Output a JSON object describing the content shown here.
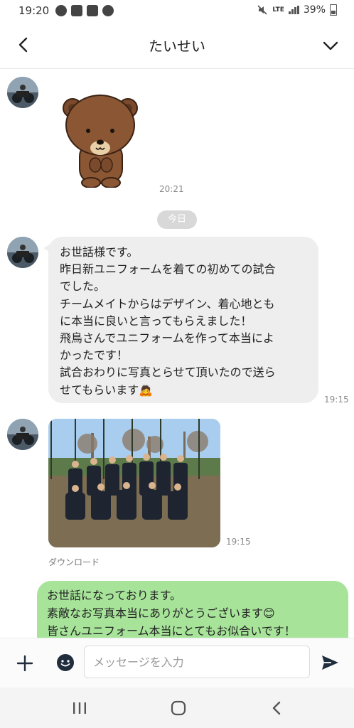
{
  "status_bar": {
    "time": "19:20",
    "network": "LTE",
    "battery": "39%"
  },
  "header": {
    "title": "たいせい"
  },
  "messages": {
    "sticker_time": "20:21",
    "date_divider": "今日",
    "text_message_lines": [
      "お世話様です。",
      "昨日新ユニフォームを着ての初めての試合",
      "でした。",
      "チームメイトからはデザイン、着心地とも",
      "に本当に良いと言ってもらえました！",
      "飛鳥さんでユニフォームを作って本当によ",
      "かったです！",
      "試合おわりに写真とらせて頂いたので送ら",
      "せてもらいます🙇"
    ],
    "text_message_time": "19:15",
    "photo_time": "19:15",
    "download_label": "ダウンロード",
    "reply_lines": [
      "お世話になっております。",
      "素敵なお写真本当にありがとうございます😊",
      "皆さんユニフォーム本当にとてもお似合いです！"
    ]
  },
  "input": {
    "placeholder": "メッセージを入力",
    "value": ""
  },
  "colors": {
    "incoming_bubble": "#eeeeee",
    "outgoing_bubble": "#a7e49a",
    "accent": "#1f2d3d"
  },
  "icons": {
    "back": "chevron-left-icon",
    "menu": "chevron-down-icon",
    "add": "plus-icon",
    "emoji": "emoji-icon",
    "send": "send-icon",
    "nav_recent": "recent-apps-icon",
    "nav_home": "home-icon",
    "nav_back": "nav-back-icon"
  }
}
